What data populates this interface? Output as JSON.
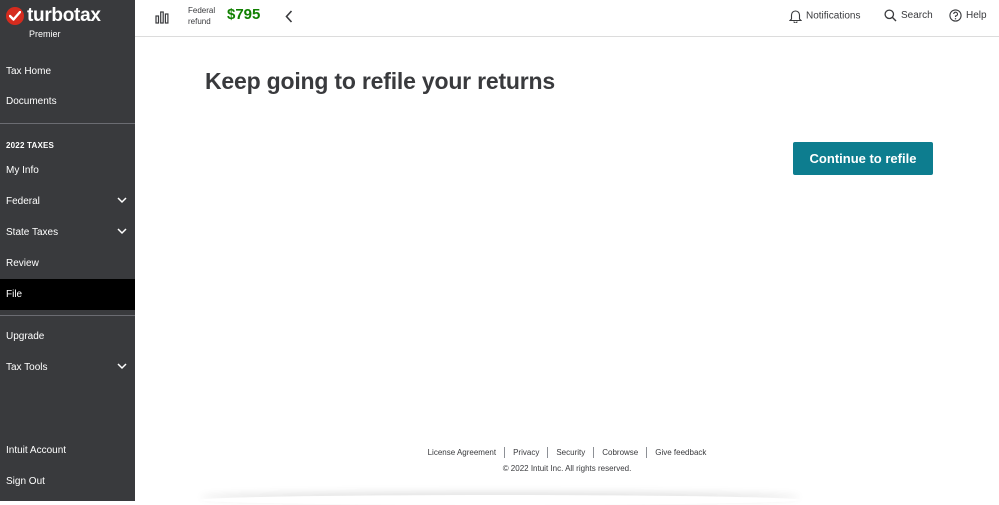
{
  "brand": {
    "name": "turbotax",
    "edition": "Premier"
  },
  "sidebar": {
    "top_items": [
      {
        "label": "Tax Home"
      },
      {
        "label": "Documents"
      }
    ],
    "section_title": "2022 TAXES",
    "section_items": [
      {
        "label": "My Info"
      },
      {
        "label": "Federal"
      },
      {
        "label": "State Taxes"
      },
      {
        "label": "Review"
      },
      {
        "label": "File"
      }
    ],
    "extra_items": [
      {
        "label": "Upgrade"
      },
      {
        "label": "Tax Tools"
      }
    ],
    "bottom_items": [
      {
        "label": "Intuit Account"
      },
      {
        "label": "Sign Out"
      }
    ],
    "active": "File"
  },
  "topbar": {
    "refund_label_line1": "Federal",
    "refund_label_line2": "refund",
    "refund_amount": "$795",
    "notifications_label": "Notifications",
    "search_label": "Search",
    "help_label": "Help"
  },
  "main": {
    "title": "Keep going to refile your returns",
    "continue_button": "Continue to refile"
  },
  "footer": {
    "links": [
      "License Agreement",
      "Privacy",
      "Security",
      "Cobrowse",
      "Give feedback"
    ],
    "copyright": "© 2022 Intuit Inc. All rights reserved."
  },
  "colors": {
    "sidebar_bg": "#393a3d",
    "active_item_bg": "#000000",
    "brand_red": "#d52b1e",
    "refund_green": "#108000",
    "button_teal": "#0d7d8f"
  },
  "icons": {
    "logo": "checkmark-icon",
    "refund_meter": "bar-chart-icon",
    "collapse": "chevron-left-icon",
    "notifications": "bell-icon",
    "search": "search-icon",
    "help": "help-circle-icon",
    "expand": "chevron-down-icon"
  }
}
